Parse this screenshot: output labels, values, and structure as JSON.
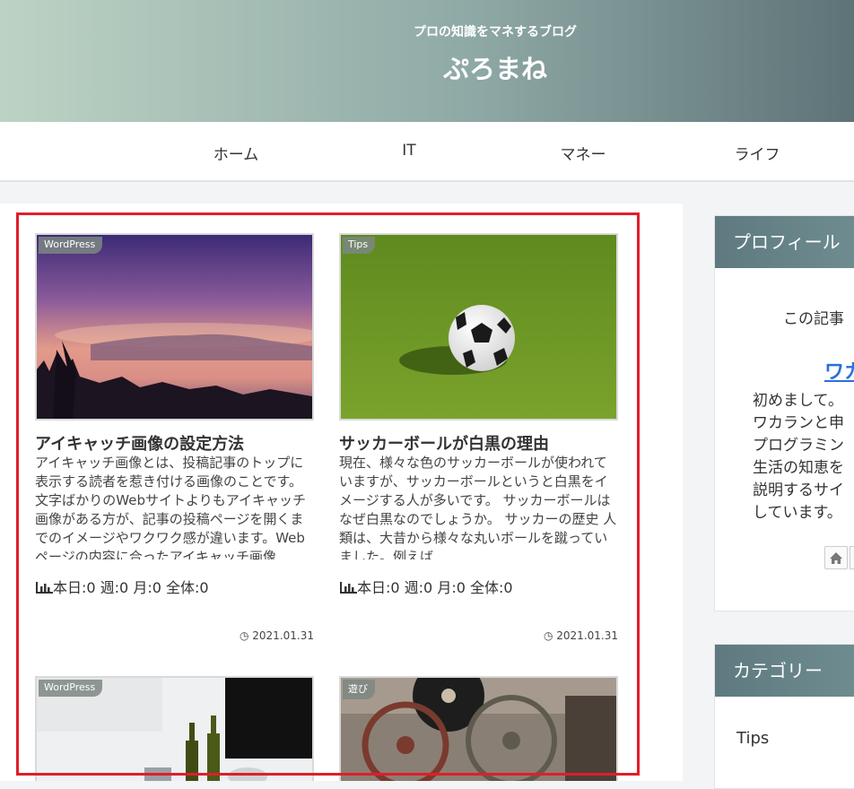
{
  "header": {
    "tagline": "プロの知識をマネするブログ",
    "title": "ぷろまね"
  },
  "nav": [
    {
      "label": "ホーム"
    },
    {
      "label": "IT"
    },
    {
      "label": "マネー"
    },
    {
      "label": "ライフ"
    }
  ],
  "cards": [
    {
      "category": "WordPress",
      "title": "アイキャッチ画像の設定方法",
      "excerpt": "アイキャッチ画像とは、投稿記事のトップに表示する読者を惹き付ける画像のことです。文字ばかりのWebサイトよりもアイキャッチ画像がある方が、記事の投稿ページを開くまでのイメージやワクワク感が違います。Webページの内容に合ったアイキャッチ画像",
      "stats": "本日:0 週:0 月:0 全体:0",
      "date": "2021.01.31"
    },
    {
      "category": "Tips",
      "title": "サッカーボールが白黒の理由",
      "excerpt": "現在、様々な色のサッカーボールが使われていますが、サッカーボールというと白黒をイメージする人が多いです。 サッカーボールはなぜ白黒なのでしょうか。 サッカーの歴史 人類は、大昔から様々な丸いボールを蹴っていました。例えば...",
      "stats": "本日:0 週:0 月:0 全体:0",
      "date": "2021.01.31"
    },
    {
      "category": "WordPress"
    },
    {
      "category": "遊び"
    }
  ],
  "sidebar": {
    "profile": {
      "heading": "プロフィール",
      "intro": "この記事",
      "name": "ワカ",
      "bio": [
        "初めまして。",
        "ワカランと申",
        "プログラミン",
        "生活の知恵を",
        "説明するサイ",
        "しています。"
      ]
    },
    "category": {
      "heading": "カテゴリー",
      "item": "Tips"
    }
  },
  "colors": {
    "highlight": "#e11d2a",
    "link": "#2a6fdb",
    "sidebar_head": "#5e7a80"
  }
}
